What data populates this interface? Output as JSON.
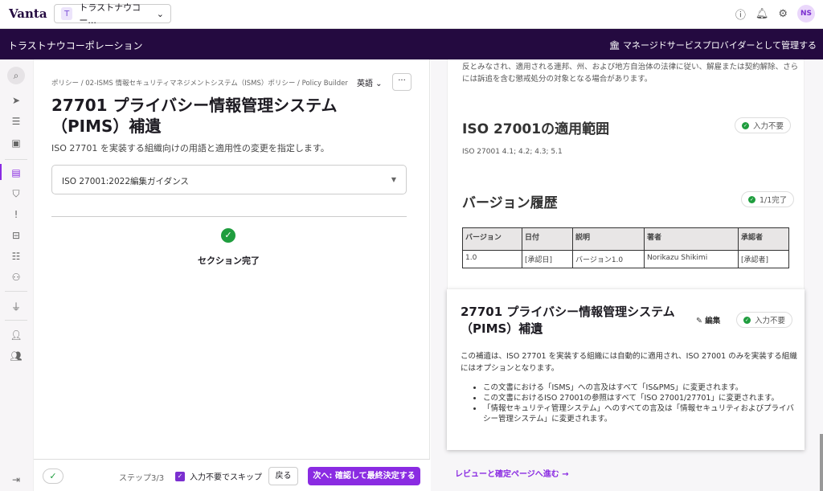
{
  "app": {
    "logo": "Vanta",
    "org_selector": "トラストナウコー...",
    "org_initial": "T",
    "avatar": "NS"
  },
  "banner": {
    "org_name": "トラストナウコーポレーション",
    "msp_label": "マネージドサービスプロバイダーとして管理する"
  },
  "left": {
    "breadcrumb": "ポリシー / 02-ISMS 情報セキュリティマネジメントシステム（ISMS）ポリシー / Policy Builder",
    "language": "英語",
    "title": "27701 プライバシー情報管理システム（PIMS）補遺",
    "description": "ISO 27701 を実装する組織向けの用語と適用性の変更を指定します。",
    "guidance_select": "ISO 27001:2022編集ガイダンス",
    "section_status": "セクション完了"
  },
  "footer": {
    "step": "ステップ3/3",
    "skip_label": "入力不要でスキップ",
    "skip_checked": true,
    "back": "戻る",
    "next": "次へ: 確認して最終決定する"
  },
  "doc": {
    "intro_text": "反とみなされ、適用される連邦、州、および地方自治体の法律に従い、解雇または契約解除、さらには訴追を含む懲戒処分の対象となる場合があります。",
    "scope_heading": "ISO 27001の適用範囲",
    "scope_badge": "入力不要",
    "scope_refs": "ISO 27001 4.1; 4.2; 4.3; 5.1",
    "version_heading": "バージョン履歴",
    "version_badge": "1/1完了",
    "table": {
      "headers": [
        "バージョン",
        "日付",
        "説明",
        "著者",
        "承認者"
      ],
      "rows": [
        [
          "1.0",
          "[承認日]",
          "バージョン1.0",
          "Norikazu Shikimi",
          "[承認者]"
        ]
      ]
    },
    "card": {
      "title": "27701 プライバシー情報管理システム（PIMS）補遺",
      "edit": "編集",
      "badge": "入力不要",
      "paragraph": "この補遺は、ISO 27701 を実装する組織には自動的に適用され、ISO 27001 のみを実装する組織にはオプションとなります。",
      "bullets": [
        "この文書における「ISMS」への言及はすべて「IS&PMS」に変更されます。",
        "この文書におけるISO 27001の参照はすべて「ISO 27001/27701」に変更されます。",
        "「情報セキュリティ管理システム」へのすべての言及は「情報セキュリティおよびプライバシー管理システム」に変更されます。"
      ]
    },
    "review_link": "レビューと確定ページへ進む →"
  }
}
